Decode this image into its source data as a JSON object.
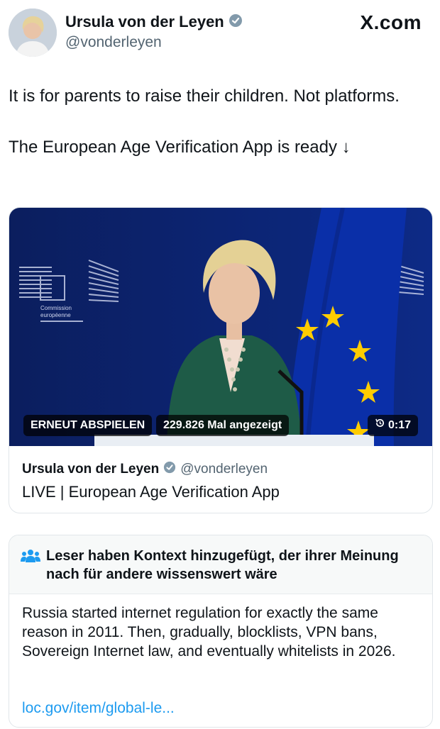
{
  "header": {
    "name": "Ursula von der Leyen",
    "handle": "@vonderleyen",
    "site": "X.com"
  },
  "post": {
    "paragraph1": "It is for parents to raise their children. Not platforms.",
    "paragraph2": "The European Age Verification App is ready ↓"
  },
  "video": {
    "replay_label": "ERNEUT ABSPIELEN",
    "views_label": "229.826 Mal angezeigt",
    "duration": "0:17",
    "backdrop_text": "Commission européenne",
    "card_name": "Ursula von der Leyen",
    "card_handle": "@vonderleyen",
    "card_title": "LIVE | European Age Verification App"
  },
  "note": {
    "header": "Leser haben Kontext hinzugefügt, der ihrer Meinung nach für andere wissenswert wäre",
    "body": "Russia started internet regulation for exactly the same reason in 2011. Then, gradually, blocklists, VPN bans, Sovereign Internet law, and eventually whitelists in 2026.",
    "link": "loc.gov/item/global-le..."
  },
  "colors": {
    "verified": "#829aab",
    "link": "#1d9bf0",
    "eu_blue": "#0a2a8a",
    "eu_gold": "#ffcc00"
  }
}
